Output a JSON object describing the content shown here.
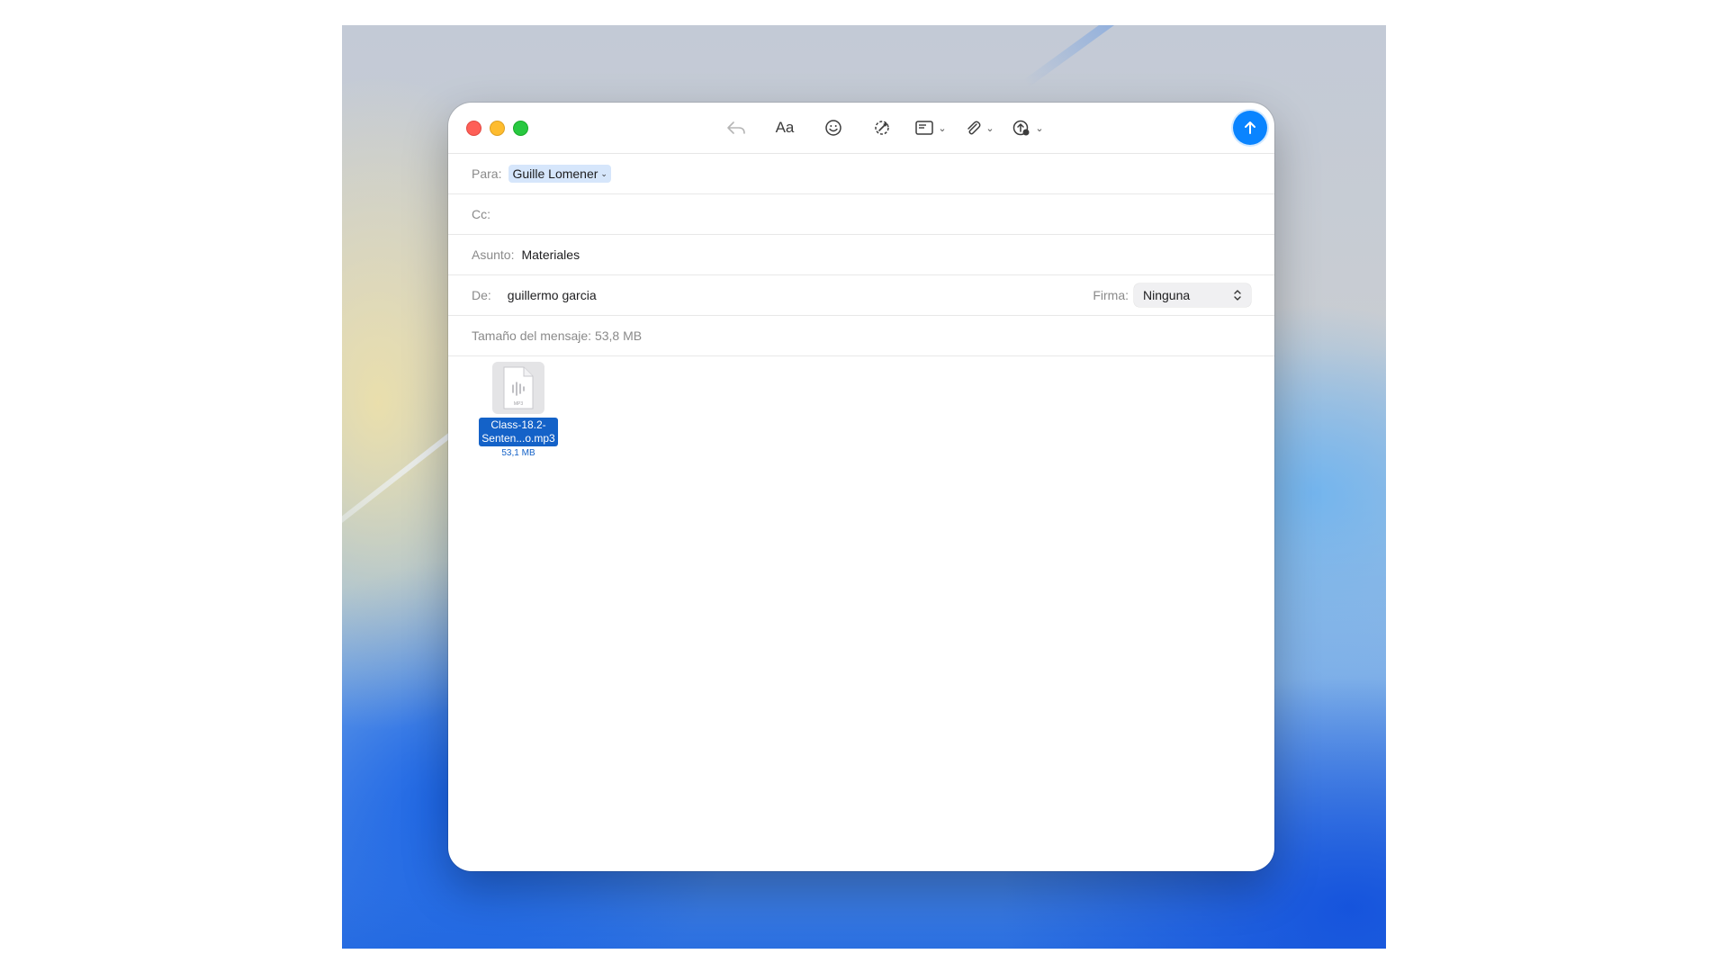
{
  "toolbar": {
    "format_label": "Aa"
  },
  "fields": {
    "to_label": "Para:",
    "to_value": "Guille Lomener",
    "cc_label": "Cc:",
    "cc_value": "",
    "subject_label": "Asunto:",
    "subject_value": "Materiales",
    "from_label": "De:",
    "from_value": "guillermo garcia",
    "signature_label": "Firma:",
    "signature_value": "Ninguna"
  },
  "message_size": "Tamaño del mensaje: 53,8 MB",
  "attachment": {
    "name": "Class-18.2-\nSenten...o.mp3",
    "size": "53,1 MB",
    "icon_label": "MP3"
  },
  "colors": {
    "accent": "#0a84ff",
    "selection": "#1462c8",
    "token": "#d6e6fb"
  }
}
